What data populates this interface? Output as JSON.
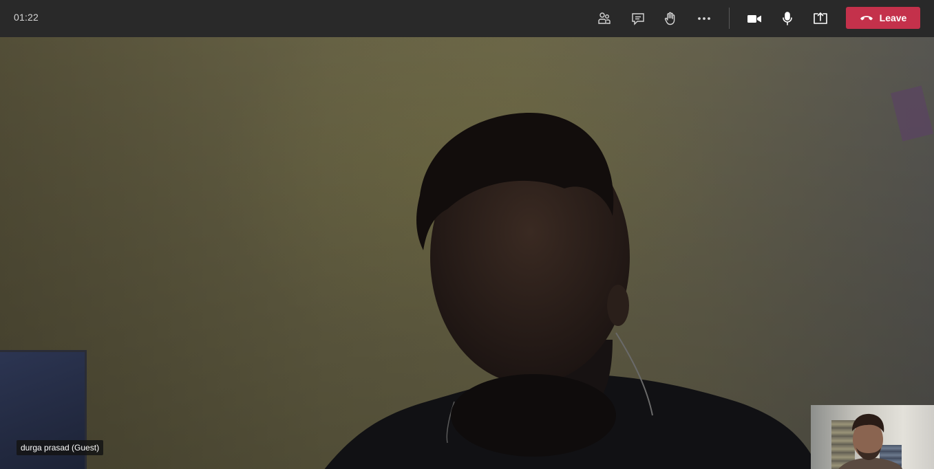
{
  "call": {
    "timer": "01:22"
  },
  "toolbar": {
    "participants_icon": "people-icon",
    "chat_icon": "chat-icon",
    "raise_hand_icon": "raise-hand-icon",
    "more_icon": "more-actions-icon",
    "camera_icon": "video-camera-icon",
    "mic_icon": "microphone-icon",
    "share_icon": "share-screen-icon",
    "leave_label": "Leave",
    "leave_color": "#c4314b"
  },
  "stage": {
    "participant_name": "durga prasad (Guest)"
  },
  "colors": {
    "topbar": "#292929",
    "icon": "#d6d6d6"
  }
}
